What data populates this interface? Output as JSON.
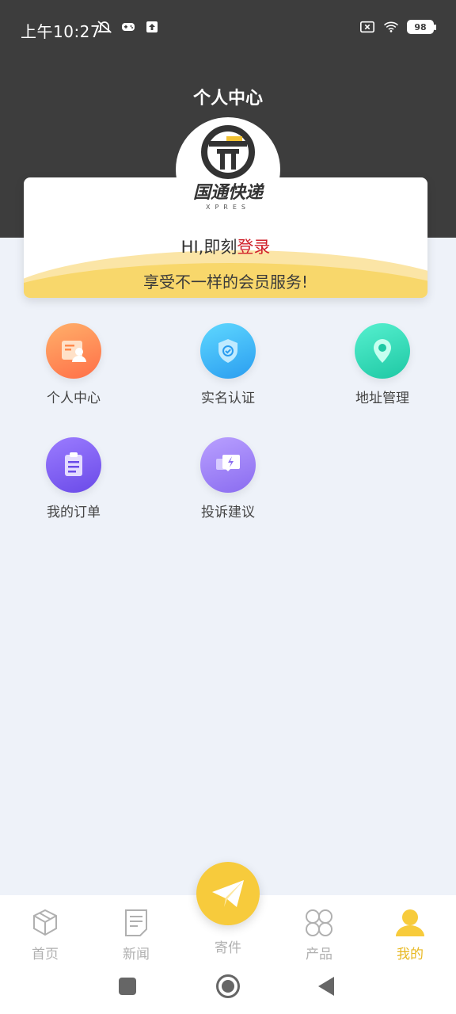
{
  "status_bar": {
    "time": "上午10:27",
    "battery": "98"
  },
  "header": {
    "title": "个人中心"
  },
  "brand": {
    "name": "国通快递",
    "sub": "XPRES"
  },
  "member_card": {
    "greeting_prefix": "HI,即刻",
    "login_link": "登录",
    "slogan": "享受不一样的会员服务!"
  },
  "menu": [
    {
      "label": "个人中心",
      "icon": "profile-card-icon",
      "color": "#ff8a4c"
    },
    {
      "label": "实名认证",
      "icon": "shield-check-icon",
      "color": "#3db8f5"
    },
    {
      "label": "地址管理",
      "icon": "location-pin-icon",
      "color": "#2de0b8"
    },
    {
      "label": "我的订单",
      "icon": "clipboard-icon",
      "color": "#7a5cf0"
    },
    {
      "label": "投诉建议",
      "icon": "chat-lightning-icon",
      "color": "#9b7af2"
    }
  ],
  "tabs": [
    {
      "label": "首页",
      "icon": "package-box-icon"
    },
    {
      "label": "新闻",
      "icon": "news-doc-icon"
    },
    {
      "label": "寄件",
      "icon": "paper-plane-icon"
    },
    {
      "label": "产品",
      "icon": "clover-grid-icon"
    },
    {
      "label": "我的",
      "icon": "user-icon",
      "active": true
    }
  ],
  "colors": {
    "accent": "#f7cb3c",
    "login": "#d0202a",
    "header_bg": "#3d3d3d",
    "page_bg": "#eef2f9"
  }
}
